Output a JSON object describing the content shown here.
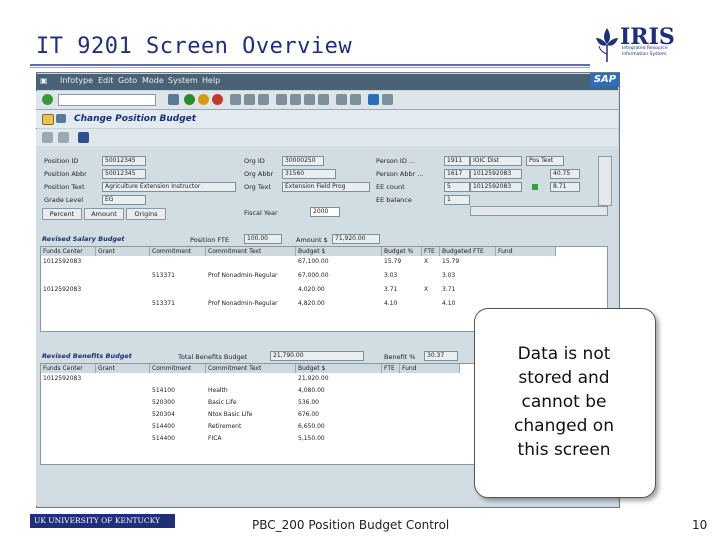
{
  "slide": {
    "title": "IT 9201 Screen Overview",
    "logo_text": "IRIS",
    "logo_subtitle": "Integrated Resource Information System",
    "callout": "Data is not stored and cannot be changed on this screen",
    "footer_org": "UK UNIVERSITY OF KENTUCKY",
    "footer_text": "PBC_200 Position Budget Control",
    "page_number": "10"
  },
  "sap": {
    "logo": "SAP",
    "menu": [
      "Infotype",
      "Edit",
      "Goto",
      "Mode",
      "System",
      "Help"
    ],
    "app_title": "Change Position Budget",
    "header": {
      "position_id_label": "Position ID",
      "position_id": "50012345",
      "position_abbr_label": "Position Abbr",
      "position_abbr": "50012345",
      "position_text_label": "Position Text",
      "position_text": "Agriculture Extension Instructor",
      "grade_level_label": "Grade Level",
      "grade_level": "EG",
      "org_id_label": "Org ID",
      "org_id": "30000250",
      "org_abbr_label": "Org Abbr",
      "org_abbr": "31560",
      "org_text_label": "Org Text",
      "org_text": "Extension Field Prog",
      "person_id_label": "Person ID ...",
      "person_id": "1911",
      "person_id_text": "IOIC Dist",
      "person_id_extra": "Pos Text",
      "person_abbr_label": "Person Abbr ...",
      "person_abbr": "1617",
      "person_abbr_text": "1012592083",
      "person_abbr_val": "40.75",
      "ee_count_label": "EE count",
      "ee_count": "5",
      "ee_count_fund": "1012592083",
      "ee_count_val": "8.71",
      "ee_balance_label": "EE balance",
      "ee_balance": "1",
      "fiscal_year_label": "Fiscal Year",
      "fiscal_year": "2000"
    },
    "buttons": [
      "Percent",
      "Amount",
      "Origins"
    ],
    "salary": {
      "section": "Revised Salary Budget",
      "position_fte_label": "Position FTE",
      "position_fte": "100.00",
      "amount_label": "Amount $",
      "amount": "71,920.00",
      "columns": [
        "Funds Center",
        "Grant",
        "Commitment",
        "Commitment Text",
        "Budget $",
        "Budget %",
        "FTE",
        "Budgeted FTE",
        "Fund"
      ],
      "rows": [
        [
          "1012592083",
          "",
          "",
          "",
          "67,100.00",
          "15.79",
          "X",
          "15.79",
          ""
        ],
        [
          "",
          "",
          "513371",
          "Prof Nonadmin-Regular",
          "67,000.00",
          "3.03",
          "",
          "3.03",
          ""
        ],
        [
          "1012592083",
          "",
          "",
          "",
          "4,020.00",
          "3.71",
          "X",
          "3.71",
          ""
        ],
        [
          "",
          "",
          "513371",
          "Prof Nonadmin-Regular",
          "4,820.00",
          "4.10",
          "",
          "4.10",
          ""
        ]
      ]
    },
    "benefits": {
      "section": "Revised Benefits Budget",
      "total_label": "Total Benefits Budget",
      "total": "21,790.00",
      "benefit_pct_label": "Benefit %",
      "benefit_pct": "30.37",
      "columns": [
        "Funds Center",
        "Grant",
        "Commitment",
        "Commitment Text",
        "Budget $",
        "FTE",
        "Fund"
      ],
      "rows": [
        [
          "1012592083",
          "",
          "",
          "",
          "21,920.00",
          "",
          ""
        ],
        [
          "",
          "",
          "514100",
          "Health",
          "4,080.00",
          "",
          ""
        ],
        [
          "",
          "",
          "520300",
          "Basic Life",
          "536.00",
          "",
          ""
        ],
        [
          "",
          "",
          "520304",
          "Ntox Basic Life",
          "676.00",
          "",
          ""
        ],
        [
          "",
          "",
          "514400",
          "Retirement",
          "6,650.00",
          "",
          ""
        ],
        [
          "",
          "",
          "514400",
          "FICA",
          "5,150.00",
          "",
          ""
        ]
      ]
    }
  },
  "colors": {
    "title": "#1f2f7a",
    "sap_background": "#c8d4dc",
    "menubar": "#4a6275"
  }
}
